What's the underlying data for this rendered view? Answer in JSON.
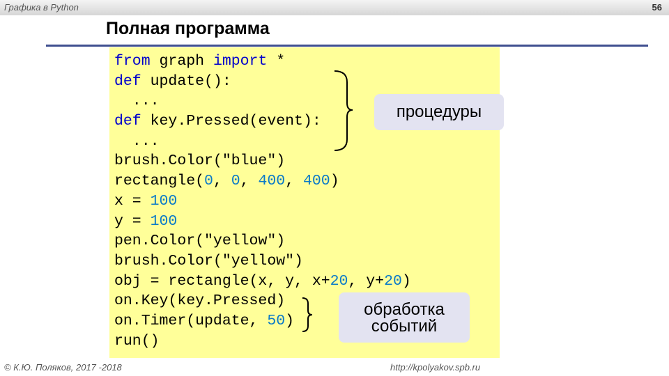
{
  "header": {
    "course": "Графика в Python",
    "page_number": "56"
  },
  "slide": {
    "title": "Полная программа"
  },
  "code": {
    "lines": [
      [
        {
          "t": "from",
          "k": "kw"
        },
        {
          "t": " graph ",
          "k": "txt"
        },
        {
          "t": "import",
          "k": "kw"
        },
        {
          "t": " *",
          "k": "txt"
        }
      ],
      [
        {
          "t": "def",
          "k": "kw"
        },
        {
          "t": " update():",
          "k": "txt"
        }
      ],
      [
        {
          "t": "  ...",
          "k": "txt"
        }
      ],
      [
        {
          "t": "def",
          "k": "kw"
        },
        {
          "t": " key.Pressed(event):",
          "k": "txt"
        }
      ],
      [
        {
          "t": "  ...",
          "k": "txt"
        }
      ],
      [
        {
          "t": "brush.Color(",
          "k": "txt"
        },
        {
          "t": "\"blue\"",
          "k": "str"
        },
        {
          "t": ")",
          "k": "txt"
        }
      ],
      [
        {
          "t": "rectangle(",
          "k": "txt"
        },
        {
          "t": "0",
          "k": "num"
        },
        {
          "t": ", ",
          "k": "txt"
        },
        {
          "t": "0",
          "k": "num"
        },
        {
          "t": ", ",
          "k": "txt"
        },
        {
          "t": "400",
          "k": "num"
        },
        {
          "t": ", ",
          "k": "txt"
        },
        {
          "t": "400",
          "k": "num"
        },
        {
          "t": ")",
          "k": "txt"
        }
      ],
      [
        {
          "t": "x = ",
          "k": "txt"
        },
        {
          "t": "100",
          "k": "num"
        }
      ],
      [
        {
          "t": "y = ",
          "k": "txt"
        },
        {
          "t": "100",
          "k": "num"
        }
      ],
      [
        {
          "t": "pen.Color(",
          "k": "txt"
        },
        {
          "t": "\"yellow\"",
          "k": "str"
        },
        {
          "t": ")",
          "k": "txt"
        }
      ],
      [
        {
          "t": "brush.Color(",
          "k": "txt"
        },
        {
          "t": "\"yellow\"",
          "k": "str"
        },
        {
          "t": ")",
          "k": "txt"
        }
      ],
      [
        {
          "t": "obj = rectangle(x, y, x+",
          "k": "txt"
        },
        {
          "t": "20",
          "k": "num"
        },
        {
          "t": ", y+",
          "k": "txt"
        },
        {
          "t": "20",
          "k": "num"
        },
        {
          "t": ")",
          "k": "txt"
        }
      ],
      [
        {
          "t": "on.Key(key.Pressed)",
          "k": "txt"
        }
      ],
      [
        {
          "t": "on.Timer(update, ",
          "k": "txt"
        },
        {
          "t": "50",
          "k": "num"
        },
        {
          "t": ")",
          "k": "txt"
        }
      ],
      [
        {
          "t": "run()",
          "k": "txt"
        }
      ]
    ]
  },
  "callouts": {
    "procedures": "процедуры",
    "events_line1": "обработка",
    "events_line2": "событий"
  },
  "footer": {
    "copyright": "© К.Ю. Поляков, 2017 -2018",
    "url": "http://kpolyakov.spb.ru"
  },
  "colors": {
    "code_background": "#ffff99",
    "keyword": "#0000cc",
    "number": "#0a7ac8",
    "title_rule": "#3f4f8f",
    "callout_background": "#e3e3f1"
  }
}
